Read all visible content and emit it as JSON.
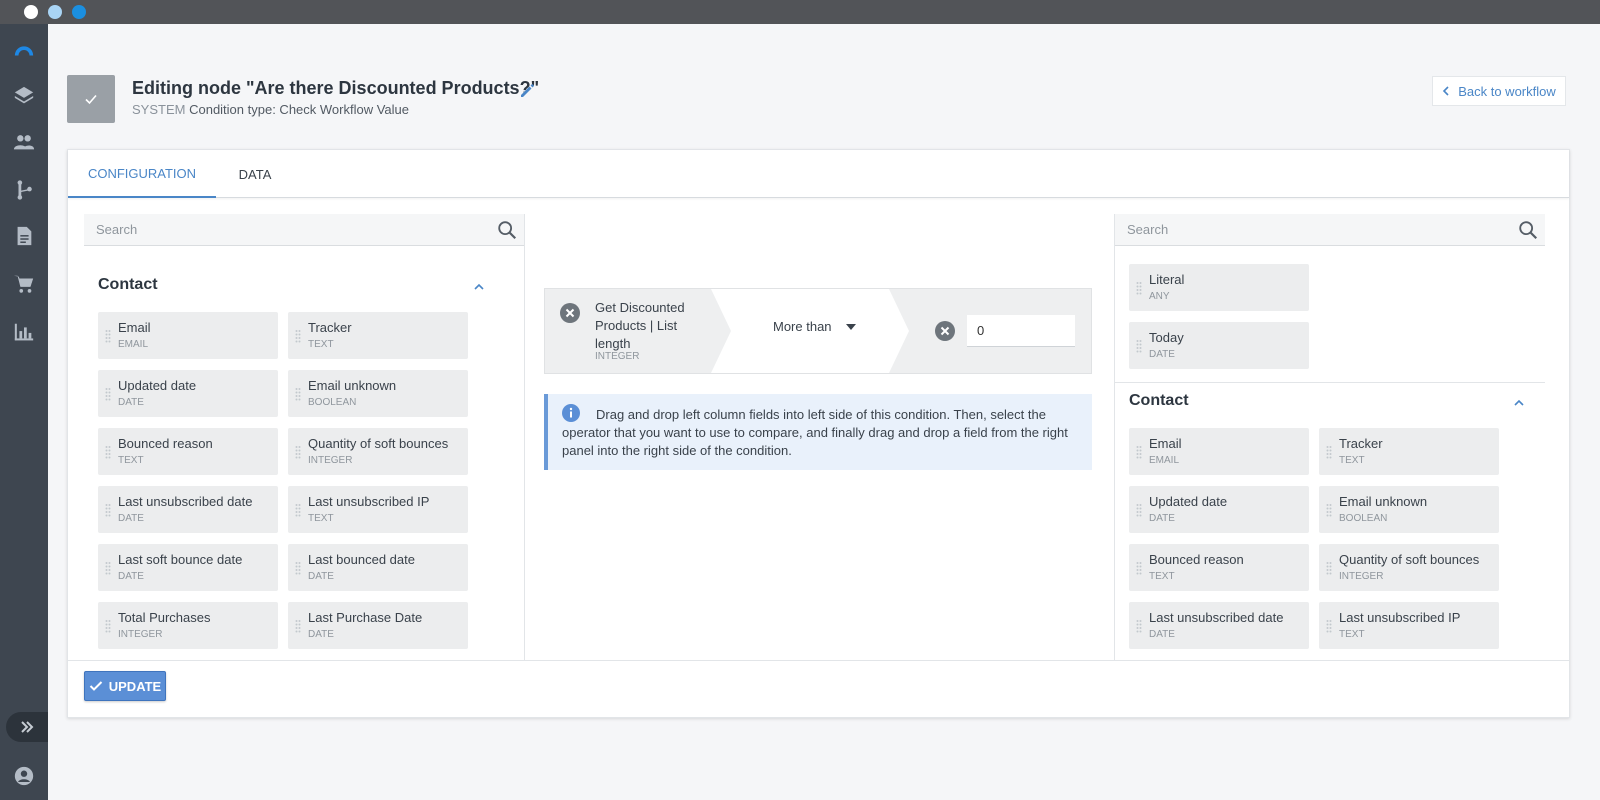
{
  "window": {
    "controls": [
      "close",
      "minimize",
      "maximize"
    ]
  },
  "nav": {
    "items": [
      "logo-icon",
      "layers-icon",
      "contacts-icon",
      "workflow-icon",
      "document-icon",
      "cart-icon",
      "reports-icon"
    ],
    "expand_icon": "double-chevron-right-icon",
    "user_icon": "user-avatar-icon"
  },
  "header": {
    "title": "Editing node \"Are there Discounted Products?\"",
    "system_label": "SYSTEM",
    "subtitle": "Condition type: Check Workflow Value",
    "back_label": "Back to workflow"
  },
  "tabs": [
    {
      "label": "CONFIGURATION",
      "active": true
    },
    {
      "label": "DATA",
      "active": false
    }
  ],
  "left_panel": {
    "search_placeholder": "Search",
    "section_title": "Contact",
    "fields": [
      {
        "name": "Email",
        "type": "EMAIL"
      },
      {
        "name": "Tracker",
        "type": "TEXT"
      },
      {
        "name": "Updated date",
        "type": "DATE"
      },
      {
        "name": "Email unknown",
        "type": "BOOLEAN"
      },
      {
        "name": "Bounced reason",
        "type": "TEXT"
      },
      {
        "name": "Quantity of soft bounces",
        "type": "INTEGER"
      },
      {
        "name": "Last unsubscribed date",
        "type": "DATE"
      },
      {
        "name": "Last unsubscribed IP",
        "type": "TEXT"
      },
      {
        "name": "Last soft bounce date",
        "type": "DATE"
      },
      {
        "name": "Last bounced date",
        "type": "DATE"
      },
      {
        "name": "Total Purchases",
        "type": "INTEGER"
      },
      {
        "name": "Last Purchase Date",
        "type": "DATE"
      }
    ]
  },
  "condition": {
    "left_field_name": "Get Discounted Products | List length",
    "left_field_type": "INTEGER",
    "operator": "More than",
    "value": "0"
  },
  "info": {
    "text": "Drag and drop left column fields into left side of this condition. Then, select the operator that you want to use to compare, and finally drag and drop a field from the right panel into the right side of the condition."
  },
  "right_panel": {
    "search_placeholder": "Search",
    "special_fields": [
      {
        "name": "Literal",
        "type": "ANY"
      },
      {
        "name": "Today",
        "type": "DATE"
      }
    ],
    "section_title": "Contact",
    "fields": [
      {
        "name": "Email",
        "type": "EMAIL"
      },
      {
        "name": "Tracker",
        "type": "TEXT"
      },
      {
        "name": "Updated date",
        "type": "DATE"
      },
      {
        "name": "Email unknown",
        "type": "BOOLEAN"
      },
      {
        "name": "Bounced reason",
        "type": "TEXT"
      },
      {
        "name": "Quantity of soft bounces",
        "type": "INTEGER"
      },
      {
        "name": "Last unsubscribed date",
        "type": "DATE"
      },
      {
        "name": "Last unsubscribed IP",
        "type": "TEXT"
      }
    ]
  },
  "footer": {
    "update_label": "UPDATE"
  },
  "colors": {
    "accent": "#4a86c7",
    "nav_bg": "#3e4650",
    "titlebar": "#525458",
    "update_btn": "#5b8fd6",
    "info_bg": "#e9f1fb"
  }
}
